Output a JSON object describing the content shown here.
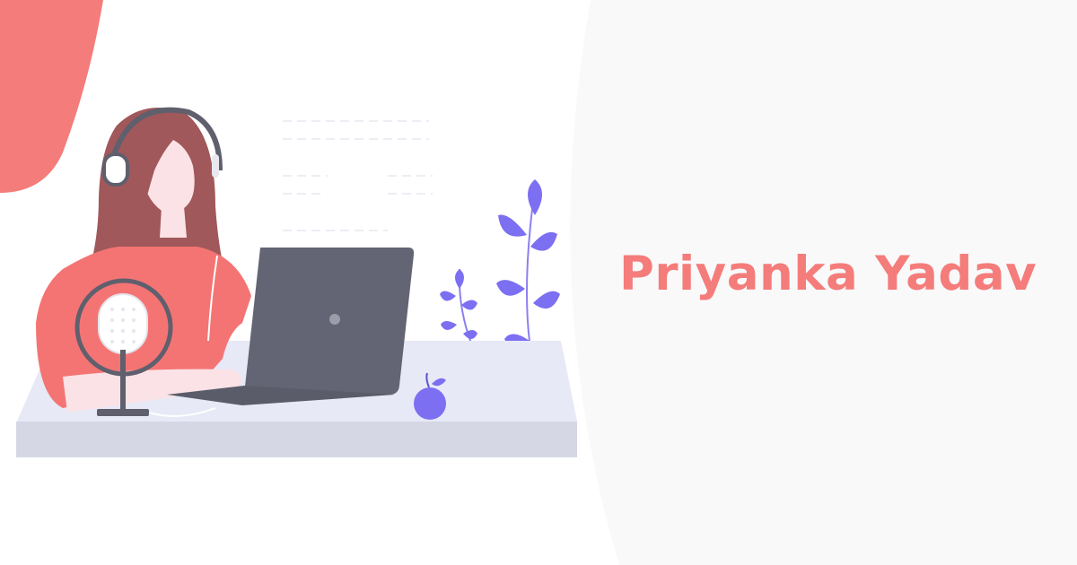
{
  "profile": {
    "name": "Priyanka Yadav"
  },
  "colors": {
    "accent": "#f47c7a",
    "panel_background": "#f9f9fa",
    "illustration_purple": "#7c6ff1",
    "laptop": "#636574",
    "desk": "#e7e9f6",
    "hair": "#a0585a",
    "shirt": "#f47474"
  },
  "illustration": {
    "icon": "woman-podcasting-at-laptop-illustration"
  }
}
